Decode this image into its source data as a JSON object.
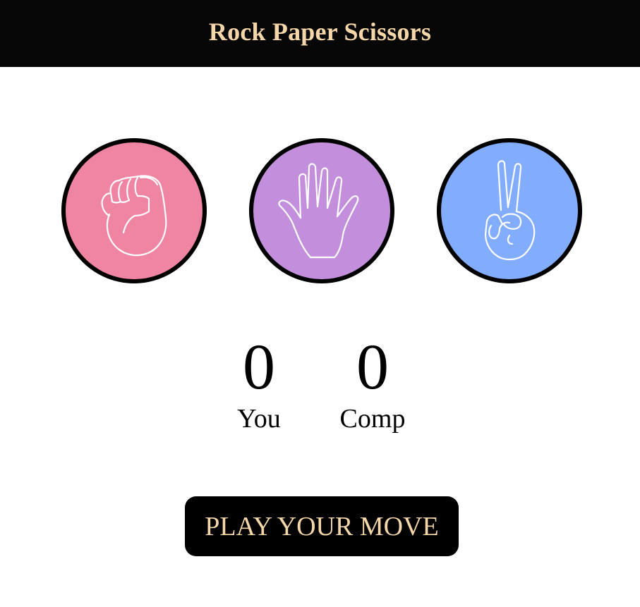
{
  "header": {
    "title": "Rock Paper Scissors"
  },
  "choices": [
    {
      "name": "rock",
      "icon": "fist-icon",
      "color": "#ef85a2"
    },
    {
      "name": "paper",
      "icon": "open-hand-icon",
      "color": "#c38fdd"
    },
    {
      "name": "scissors",
      "icon": "peace-hand-icon",
      "color": "#82adfe"
    }
  ],
  "score": {
    "you_value": "0",
    "you_label": "You",
    "comp_value": "0",
    "comp_label": "Comp"
  },
  "play_button": {
    "label": "PLAY YOUR MOVE"
  },
  "colors": {
    "header_bg": "#070707",
    "accent_text": "#f5d6a8"
  }
}
